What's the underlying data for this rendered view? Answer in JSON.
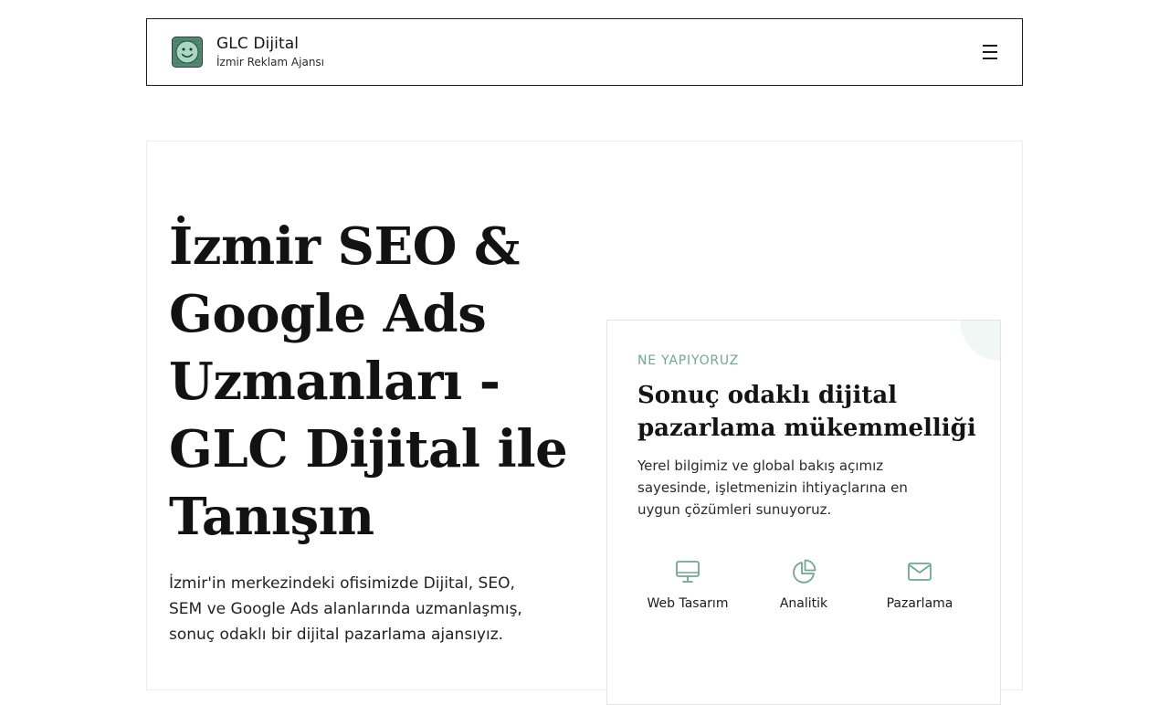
{
  "header": {
    "logo_icon": "smiley-face-logo-icon",
    "brand_name": "GLC Dijital",
    "brand_tagline": "İzmir Reklam Ajansı",
    "menu_icon": "hamburger-menu-icon"
  },
  "hero": {
    "title": "İzmir SEO & Google Ads Uzmanları - GLC Dijital ile Tanışın",
    "description": "İzmir'in merkezindeki ofisimizde Dijital, SEO, SEM ve Google Ads alanlarında uzmanlaşmış, sonuç odaklı bir dijital pazarlama ajansıyız."
  },
  "card": {
    "kicker": "NE YAPIYORUZ",
    "title": "Sonuç odaklı dijital pazarlama mükemmelliği",
    "text": "Yerel bilgimiz ve global bakış açımız sayesinde, işletmenizin ihtiyaçlarına en uygun çözümleri sunuyoruz.",
    "features": [
      {
        "icon": "monitor-icon",
        "label": "Web Tasarım"
      },
      {
        "icon": "pie-chart-icon",
        "label": "Analitik"
      },
      {
        "icon": "mail-icon",
        "label": "Pazarlama"
      }
    ]
  },
  "colors": {
    "accent": "#6fa891",
    "text": "#141414",
    "border": "#1a1a1a"
  }
}
